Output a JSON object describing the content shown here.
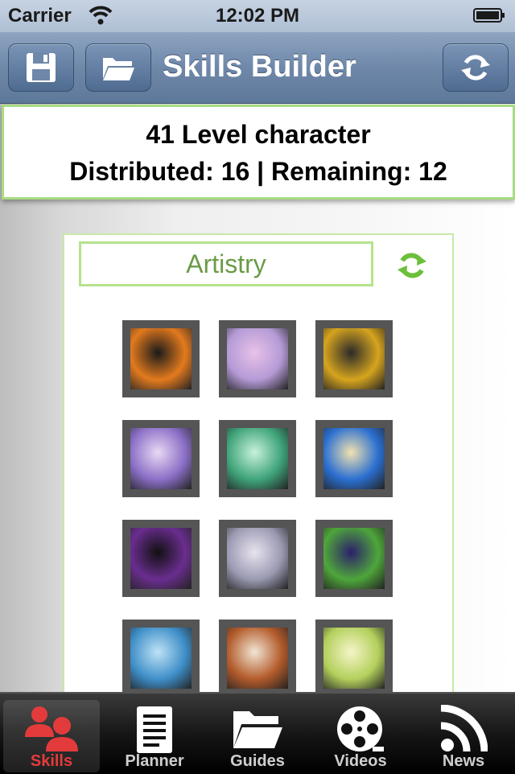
{
  "status_bar": {
    "carrier": "Carrier",
    "time": "12:02 PM"
  },
  "navbar": {
    "title": "Skills Builder",
    "icons": [
      "save-icon",
      "folder-icon",
      "refresh-icon"
    ]
  },
  "summary": {
    "level_line": "41 Level character",
    "points_line": "Distributed: 16 | Remaining: 12"
  },
  "tree": {
    "name": "Artistry",
    "reset_icon": "reset-icon"
  },
  "skills": [
    {
      "name": "skill-shield-slot",
      "colors": [
        "#e37a1e",
        "#1a1a1a"
      ]
    },
    {
      "name": "skill-music-notes",
      "colors": [
        "#b49ad6",
        "#e8c2e8"
      ]
    },
    {
      "name": "skill-golden-notes",
      "colors": [
        "#d6a41e",
        "#2a2a2a"
      ]
    },
    {
      "name": "skill-screaming-face",
      "colors": [
        "#8b6fc7",
        "#e9d9f3"
      ]
    },
    {
      "name": "skill-green-melody",
      "colors": [
        "#3fa47a",
        "#c8f2d9"
      ]
    },
    {
      "name": "skill-blue-wave",
      "colors": [
        "#2b6fd1",
        "#f2e2b0"
      ]
    },
    {
      "name": "skill-sleeping-eye",
      "colors": [
        "#6a2d8f",
        "#111111"
      ]
    },
    {
      "name": "skill-sword-notes",
      "colors": [
        "#9a9ab2",
        "#e9e3ef"
      ]
    },
    {
      "name": "skill-aurora-clef",
      "colors": [
        "#4ea63b",
        "#2c1f6b"
      ]
    },
    {
      "name": "skill-lyre",
      "colors": [
        "#3f8fc9",
        "#bfe2f5"
      ]
    },
    {
      "name": "skill-roaring-lion",
      "colors": [
        "#b35b2b",
        "#f1e6d4"
      ]
    },
    {
      "name": "skill-horn",
      "colors": [
        "#b3d05c",
        "#f5f5c8"
      ]
    }
  ],
  "tabs": [
    {
      "label": "Skills",
      "icon": "people-icon",
      "active": true
    },
    {
      "label": "Planner",
      "icon": "document-icon",
      "active": false
    },
    {
      "label": "Guides",
      "icon": "folder-icon",
      "active": false
    },
    {
      "label": "Videos",
      "icon": "film-reel-icon",
      "active": false
    },
    {
      "label": "News",
      "icon": "rss-icon",
      "active": false
    }
  ],
  "colors": {
    "accent_green": "#a7dc83",
    "tree_text": "#6a9b48",
    "active_tab": "#e33b3b",
    "navbar_blue": "#6f88aa"
  }
}
